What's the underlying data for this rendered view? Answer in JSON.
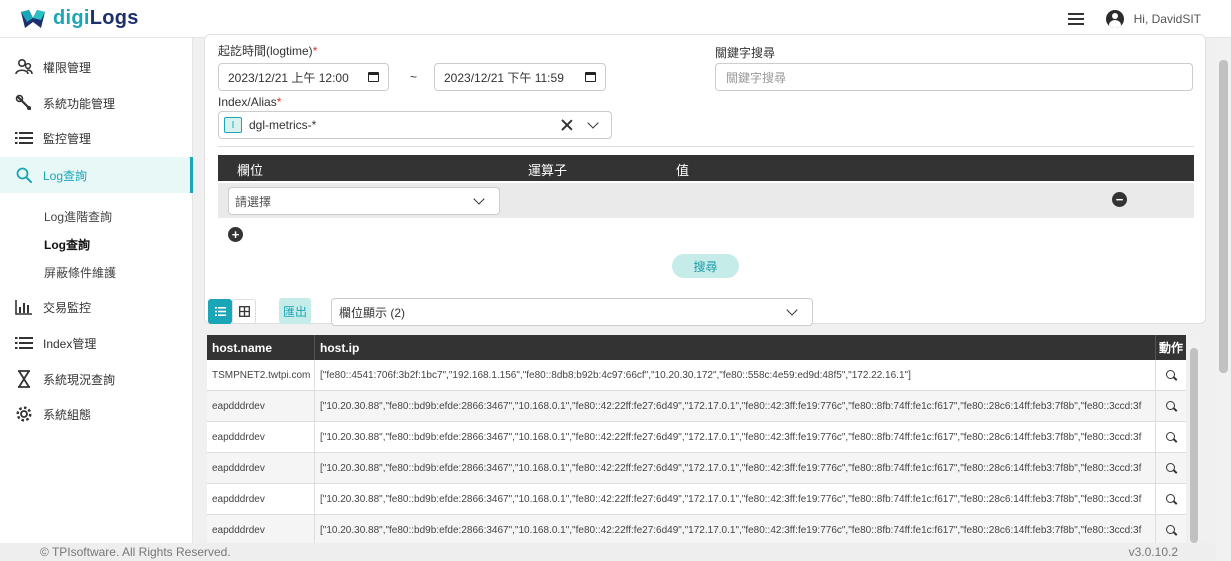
{
  "header": {
    "logo_part1": "digi",
    "logo_part2": "Logs",
    "user_greeting": "Hi, DavidSIT"
  },
  "sidebar": {
    "items": [
      {
        "label": "權限管理",
        "icon": "user-group-icon"
      },
      {
        "label": "系統功能管理",
        "icon": "wrench-icon"
      },
      {
        "label": "監控管理",
        "icon": "list-icon"
      },
      {
        "label": "Log查詢",
        "icon": "search-icon"
      },
      {
        "label": "交易監控",
        "icon": "bar-chart-icon"
      },
      {
        "label": "Index管理",
        "icon": "list-icon"
      },
      {
        "label": "系統現況查詢",
        "icon": "hourglass-icon"
      },
      {
        "label": "系統組態",
        "icon": "gear-icon"
      }
    ],
    "sub_items": [
      "Log進階查詢",
      "Log查詢",
      "屏蔽條件維護"
    ]
  },
  "filter": {
    "time_label": "起訖時間(logtime)",
    "required_mark": "*",
    "start_datetime": "2023/12/21 上午 12:00",
    "tilde": "~",
    "end_datetime": "2023/12/21 下午 11:59",
    "keyword_label": "關鍵字搜尋",
    "keyword_placeholder": "關鍵字搜尋",
    "index_label": "Index/Alias",
    "index_badge": "I",
    "index_value": "dgl-metrics-*",
    "conditions": {
      "headers": [
        "欄位",
        "運算子",
        "值"
      ],
      "field_placeholder": "請選擇"
    },
    "search_button": "搜尋"
  },
  "toolbar": {
    "export_button": "匯出",
    "column_display": "欄位顯示 (2)"
  },
  "table": {
    "headers": [
      "host.name",
      "host.ip",
      "動作"
    ],
    "rows": [
      {
        "name": "TSMPNET2.twtpi.com",
        "ip": "[\"fe80::4541:706f:3b2f:1bc7\",\"192.168.1.156\",\"fe80::8db8:b92b:4c97:66cf\",\"10.20.30.172\",\"fe80::558c:4e59:ed9d:48f5\",\"172.22.16.1\"]"
      },
      {
        "name": "eapdddrdev",
        "ip": "[\"10.20.30.88\",\"fe80::bd9b:efde:2866:3467\",\"10.168.0.1\",\"fe80::42:22ff:fe27:6d49\",\"172.17.0.1\",\"fe80::42:3ff:fe19:776c\",\"fe80::8fb:74ff:fe1c:f617\",\"fe80::28c6:14ff:feb3:7f8b\",\"fe80::3ccd:3f"
      },
      {
        "name": "eapdddrdev",
        "ip": "[\"10.20.30.88\",\"fe80::bd9b:efde:2866:3467\",\"10.168.0.1\",\"fe80::42:22ff:fe27:6d49\",\"172.17.0.1\",\"fe80::42:3ff:fe19:776c\",\"fe80::8fb:74ff:fe1c:f617\",\"fe80::28c6:14ff:feb3:7f8b\",\"fe80::3ccd:3f"
      },
      {
        "name": "eapdddrdev",
        "ip": "[\"10.20.30.88\",\"fe80::bd9b:efde:2866:3467\",\"10.168.0.1\",\"fe80::42:22ff:fe27:6d49\",\"172.17.0.1\",\"fe80::42:3ff:fe19:776c\",\"fe80::8fb:74ff:fe1c:f617\",\"fe80::28c6:14ff:feb3:7f8b\",\"fe80::3ccd:3f"
      },
      {
        "name": "eapdddrdev",
        "ip": "[\"10.20.30.88\",\"fe80::bd9b:efde:2866:3467\",\"10.168.0.1\",\"fe80::42:22ff:fe27:6d49\",\"172.17.0.1\",\"fe80::42:3ff:fe19:776c\",\"fe80::8fb:74ff:fe1c:f617\",\"fe80::28c6:14ff:feb3:7f8b\",\"fe80::3ccd:3f"
      },
      {
        "name": "eapdddrdev",
        "ip": "[\"10.20.30.88\",\"fe80::bd9b:efde:2866:3467\",\"10.168.0.1\",\"fe80::42:22ff:fe27:6d49\",\"172.17.0.1\",\"fe80::42:3ff:fe19:776c\",\"fe80::8fb:74ff:fe1c:f617\",\"fe80::28c6:14ff:feb3:7f8b\",\"fe80::3ccd:3f"
      }
    ]
  },
  "footer": {
    "copyright": "© TPIsoftware. All Rights Reserved.",
    "version": "v3.0.10.2"
  },
  "colors": {
    "accent": "#1aa6b7",
    "brand_dark": "#1c2f6e",
    "header_dark": "#333333"
  }
}
